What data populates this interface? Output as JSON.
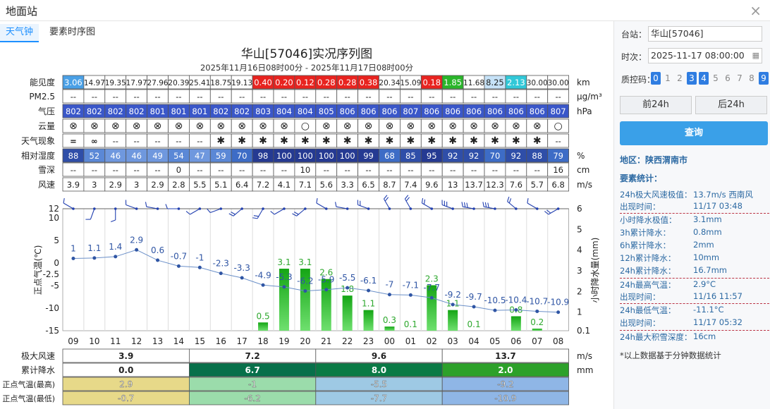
{
  "window": {
    "title": "地面站"
  },
  "tabs": [
    {
      "label": "天气钟"
    },
    {
      "label": "要素时序图"
    }
  ],
  "chart": {
    "title": "华山[57046]实况序列图",
    "subtitle": "2025年11月16日08时00分 - 2025年11月17日08时00分"
  },
  "hours": [
    "09",
    "10",
    "11",
    "12",
    "13",
    "14",
    "15",
    "16",
    "17",
    "18",
    "19",
    "20",
    "21",
    "22",
    "23",
    "00",
    "01",
    "02",
    "03",
    "04",
    "05",
    "06",
    "07",
    "08"
  ],
  "table_rows": [
    {
      "label": "能见度",
      "unit": "km",
      "type": "vis",
      "values": [
        "3.06",
        "14.97",
        "19.35",
        "17.97",
        "27.96",
        "20.39",
        "25.41",
        "18.75",
        "19.13",
        "0.40",
        "0.20",
        "0.12",
        "0.28",
        "0.28",
        "0.38",
        "20.34",
        "15.09",
        "0.18",
        "1.85",
        "11.68",
        "8.25",
        "2.13",
        "30.00",
        "30.00"
      ]
    },
    {
      "label": "PM2.5",
      "unit": "μg/m³",
      "type": "plain",
      "values": [
        "--",
        "--",
        "--",
        "--",
        "--",
        "--",
        "--",
        "--",
        "--",
        "--",
        "--",
        "--",
        "--",
        "--",
        "--",
        "--",
        "--",
        "--",
        "--",
        "--",
        "--",
        "--",
        "--",
        "--"
      ]
    },
    {
      "label": "气压",
      "unit": "hPa",
      "type": "pres",
      "values": [
        "802",
        "802",
        "802",
        "802",
        "801",
        "801",
        "801",
        "802",
        "802",
        "803",
        "804",
        "804",
        "805",
        "806",
        "806",
        "806",
        "807",
        "806",
        "806",
        "806",
        "806",
        "806",
        "806",
        "807"
      ]
    },
    {
      "label": "云量",
      "unit": "",
      "type": "plain",
      "values": [
        "⊗",
        "⊗",
        "⊗",
        "⊗",
        "⊗",
        "⊗",
        "⊗",
        "⊗",
        "⊗",
        "⊗",
        "⊗",
        "○",
        "⊗",
        "⊗",
        "⊗",
        "⊗",
        "⊗",
        "⊗",
        "⊗",
        "⊗",
        "⊗",
        "⊗",
        "⊗",
        "○"
      ]
    },
    {
      "label": "天气现象",
      "unit": "",
      "type": "plain",
      "values": [
        "=",
        "∞",
        "--",
        "--",
        "--",
        "--",
        "--",
        "✱",
        "✱",
        "✱",
        "✱",
        "✱",
        "✱",
        "✱",
        "✱",
        "✱",
        "✱",
        "✱",
        "✱",
        "✱",
        "✱",
        "✱",
        "✱",
        "--"
      ]
    },
    {
      "label": "相对湿度",
      "unit": "%",
      "type": "hum",
      "values": [
        "88",
        "52",
        "46",
        "46",
        "49",
        "54",
        "47",
        "59",
        "70",
        "98",
        "100",
        "100",
        "100",
        "100",
        "99",
        "68",
        "85",
        "95",
        "92",
        "92",
        "70",
        "92",
        "88",
        "79"
      ]
    },
    {
      "label": "雪深",
      "unit": "cm",
      "type": "plain",
      "values": [
        "--",
        "--",
        "--",
        "--",
        "--",
        "0",
        "--",
        "--",
        "--",
        "--",
        "--",
        "10",
        "--",
        "--",
        "--",
        "--",
        "--",
        "--",
        "--",
        "--",
        "--",
        "--",
        "--",
        "16"
      ]
    },
    {
      "label": "风速",
      "unit": "m/s",
      "type": "plain",
      "values": [
        "3.9",
        "3",
        "2.9",
        "3",
        "2.9",
        "2.8",
        "5.5",
        "5.1",
        "6.4",
        "7.2",
        "4.1",
        "7.1",
        "5.6",
        "3.3",
        "6.5",
        "8.7",
        "7.4",
        "9.6",
        "13",
        "13.7",
        "12.3",
        "7.6",
        "5.7",
        "6.8"
      ]
    }
  ],
  "colors": {
    "vis_blue": "#4aa0e6",
    "vis_orange": "#f19a1f",
    "vis_red": "#e8231f",
    "vis_green": "#2ab52a",
    "vis_pale": "#c6e2f7",
    "vis_cyan": "#31c8d8",
    "pres_blue": "#3a57c9",
    "hum_dark": "#253a92",
    "temp_line": "#2f55a4",
    "rain_green": "#27c427"
  },
  "chart_data": {
    "type": "line",
    "x": [
      "09",
      "10",
      "11",
      "12",
      "13",
      "14",
      "15",
      "16",
      "17",
      "18",
      "19",
      "20",
      "21",
      "22",
      "23",
      "00",
      "01",
      "02",
      "03",
      "04",
      "05",
      "06",
      "07",
      "08"
    ],
    "series": [
      {
        "values": [
          1,
          1.1,
          1.4,
          2.9,
          0.6,
          -0.7,
          -1,
          -2.3,
          -3.3,
          -4.9,
          -5.3,
          -6.2,
          -5.9,
          -5.5,
          -6.1,
          -7,
          -7.1,
          -7.7,
          -9.2,
          -9.7,
          -10.5,
          -10.4,
          -10.7,
          -10.9
        ]
      },
      {
        "values": [
          0,
          0,
          0,
          0,
          0,
          0,
          0,
          0,
          0,
          0.5,
          3.1,
          3.1,
          2.6,
          1.8,
          1.1,
          0.3,
          0.1,
          2.3,
          1.1,
          0.1,
          0,
          0.8,
          0.2,
          0
        ]
      }
    ],
    "ylabel": "正点气温(℃)",
    "y2label": "小时降水量(mm)",
    "yticks": [
      "12",
      "10",
      "5",
      "0",
      "-2.5",
      "-5",
      "-10",
      "-15"
    ],
    "y2ticks": [
      "6",
      "5",
      "4",
      "3",
      "2",
      "1",
      "0.1"
    ],
    "wind_dirs": [
      300,
      200,
      180,
      290,
      280,
      270,
      240,
      250,
      230,
      210,
      240,
      230,
      300,
      280,
      290,
      330,
      330,
      300,
      290,
      280,
      280,
      310,
      300,
      240
    ]
  },
  "summary": {
    "rows": [
      {
        "label": "极大风速",
        "unit": "m/s",
        "values": [
          "3.9",
          "7.2",
          "9.6",
          "13.7"
        ]
      },
      {
        "label": "累计降水",
        "unit": "mm",
        "values": [
          "0.0",
          "6.7",
          "8.0",
          "2.0"
        ]
      },
      {
        "label": "正点气温(最高)",
        "unit": "",
        "values": [
          "2.9",
          "-1",
          "-5.5",
          "-9.2"
        ]
      },
      {
        "label": "正点气温(最低)",
        "unit": "",
        "values": [
          "-0.7",
          "-6.2",
          "-7.7",
          "-10.9"
        ]
      }
    ],
    "rain_colors": [
      "#ffffff",
      "#07704a",
      "#0a7a45",
      "#2da12a"
    ],
    "temp_colors": [
      "#e7d989",
      "#9bdcab",
      "#9ec9e4",
      "#8fb6e6"
    ]
  },
  "side": {
    "station_label": "台站：",
    "station_value": "华山[57046]",
    "time_label": "时次：",
    "time_value": "2025-11-17 08:00:00",
    "qc_label": "质控码：",
    "qc_codes": [
      "0",
      "1",
      "2",
      "3",
      "4",
      "5",
      "6",
      "7",
      "8",
      "9"
    ],
    "prev_label": "前24h",
    "next_label": "后24h",
    "query_label": "查询",
    "region": "地区：陕西渭南市",
    "stats_title": "要素统计：",
    "stats": [
      {
        "l": "24h极大风速极值：",
        "v": "13.7m/s 西南风"
      },
      {
        "l": "出现时间：",
        "v": "11/17 03:48"
      },
      {
        "l": "小时降水极值：",
        "v": "3.1mm"
      },
      {
        "l": "3h累计降水：",
        "v": "0.8mm"
      },
      {
        "l": "6h累计降水：",
        "v": "2mm"
      },
      {
        "l": "12h累计降水：",
        "v": "10mm"
      },
      {
        "l": "24h累计降水：",
        "v": "16.7mm"
      },
      {
        "l": "24h最高气温：",
        "v": "2.9°C"
      },
      {
        "l": "出现时间：",
        "v": "11/16 11:57"
      },
      {
        "l": "24h最低气温：",
        "v": "-11.1°C"
      },
      {
        "l": "出现时间：",
        "v": "11/17 05:32"
      },
      {
        "l": "24h最大积雪深度：",
        "v": "16cm"
      }
    ],
    "note": "*以上数据基于分钟数据统计"
  }
}
